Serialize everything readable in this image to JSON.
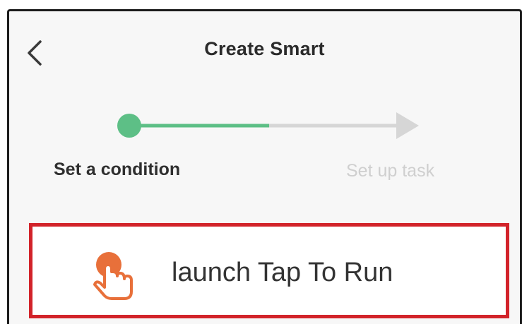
{
  "header": {
    "title": "Create Smart",
    "back_icon": "chevron-left-icon"
  },
  "stepper": {
    "steps": [
      {
        "label": "Set a condition",
        "state": "active"
      },
      {
        "label": "Set up task",
        "state": "inactive"
      }
    ],
    "colors": {
      "active": "#5dbf86",
      "inactive": "#d6d6d6"
    }
  },
  "options": [
    {
      "label": "launch Tap To Run",
      "icon": "tap-hand-icon",
      "icon_color": "#e8703a",
      "highlight_color": "#d2232a"
    }
  ]
}
